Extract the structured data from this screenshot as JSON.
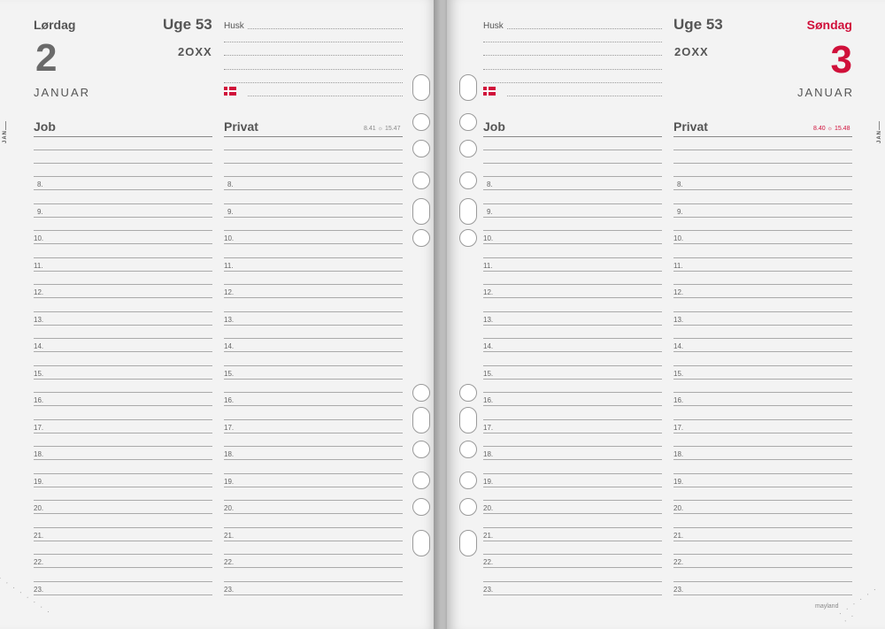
{
  "hours": [
    "8.",
    "9.",
    "10.",
    "11.",
    "12.",
    "13.",
    "14.",
    "15.",
    "16.",
    "17.",
    "18.",
    "19.",
    "20.",
    "21.",
    "22.",
    "23."
  ],
  "left_page": {
    "weekday": "Lørdag",
    "day": "2",
    "month": "JANUAR",
    "week": "Uge 53",
    "year": "2OXX",
    "husk": "Husk",
    "job": "Job",
    "privat": "Privat",
    "sunrise": "8.41",
    "sunset": "15.47",
    "tab": "JAN"
  },
  "right_page": {
    "weekday": "Søndag",
    "day": "3",
    "month": "JANUAR",
    "week": "Uge 53",
    "year": "2OXX",
    "husk": "Husk",
    "job": "Job",
    "privat": "Privat",
    "sunrise": "8.40",
    "sunset": "15.48",
    "tab": "JAN",
    "brand": "mayland"
  },
  "colors": {
    "accent_red": "#d0103a",
    "text": "#555555",
    "paper": "#f3f3f3"
  },
  "icons": [
    "danish-flag-icon",
    "sun-icon",
    "binder-hole-icon"
  ]
}
